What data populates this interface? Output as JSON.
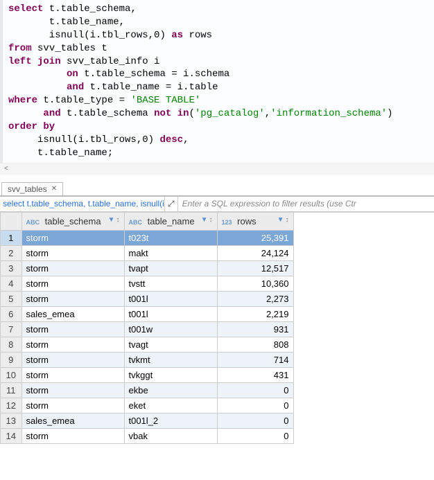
{
  "editor": {
    "sql_tokens": [
      [
        [
          "kw",
          "select"
        ],
        [
          "iden",
          " t.table_schema,"
        ]
      ],
      [
        [
          "iden",
          "       t.table_name,"
        ]
      ],
      [
        [
          "iden",
          "       isnull(i.tbl_rows,"
        ],
        [
          "num",
          "0"
        ],
        [
          "iden",
          ") "
        ],
        [
          "kw",
          "as"
        ],
        [
          "iden",
          " rows"
        ]
      ],
      [
        [
          "kw",
          "from"
        ],
        [
          "iden",
          " svv_tables t"
        ]
      ],
      [
        [
          "kw",
          "left join"
        ],
        [
          "iden",
          " svv_table_info i"
        ]
      ],
      [
        [
          "iden",
          "          "
        ],
        [
          "kw",
          "on"
        ],
        [
          "iden",
          " t.table_schema = i.schema"
        ]
      ],
      [
        [
          "iden",
          "          "
        ],
        [
          "kw",
          "and"
        ],
        [
          "iden",
          " t.table_name = i.table"
        ]
      ],
      [
        [
          "kw",
          "where"
        ],
        [
          "iden",
          " t.table_type = "
        ],
        [
          "strg",
          "'BASE TABLE'"
        ]
      ],
      [
        [
          "iden",
          "      "
        ],
        [
          "kw",
          "and"
        ],
        [
          "iden",
          " t.table_schema "
        ],
        [
          "kw",
          "not"
        ],
        [
          "iden",
          " "
        ],
        [
          "kw",
          "in"
        ],
        [
          "iden",
          "("
        ],
        [
          "strg",
          "'pg_catalog'"
        ],
        [
          "iden",
          ","
        ],
        [
          "strg",
          "'information_schema'"
        ],
        [
          "iden",
          ")"
        ]
      ],
      [
        [
          "kw",
          "order by"
        ]
      ],
      [
        [
          "iden",
          "     isnull(i.tbl_rows,"
        ],
        [
          "num",
          "0"
        ],
        [
          "iden",
          ") "
        ],
        [
          "kw",
          "desc"
        ],
        [
          "iden",
          ","
        ]
      ],
      [
        [
          "iden",
          "     t.table_name;"
        ]
      ]
    ]
  },
  "scroll_arrow": "<",
  "tabs": {
    "items": [
      {
        "label": "svv_tables"
      }
    ],
    "close_glyph": "✕"
  },
  "filter_bar": {
    "sql_snippet": "select t.table_schema, t.table_name, isnull(i.tbl",
    "expand_glyph": "⤢",
    "placeholder": "Enter a SQL expression to filter results (use Ctr"
  },
  "grid": {
    "columns": [
      {
        "type_badge": "ABC",
        "label": "table_schema"
      },
      {
        "type_badge": "ABC",
        "label": "table_name"
      },
      {
        "type_badge": "123",
        "label": "rows"
      }
    ],
    "filter_glyph": "▼",
    "sort_glyph": "↕",
    "rows": [
      {
        "n": "1",
        "schema": "storm",
        "tname": "t023t",
        "rows": "25,391",
        "selected": true
      },
      {
        "n": "2",
        "schema": "storm",
        "tname": "makt",
        "rows": "24,124",
        "selected": false
      },
      {
        "n": "3",
        "schema": "storm",
        "tname": "tvapt",
        "rows": "12,517",
        "selected": false
      },
      {
        "n": "4",
        "schema": "storm",
        "tname": "tvstt",
        "rows": "10,360",
        "selected": false
      },
      {
        "n": "5",
        "schema": "storm",
        "tname": "t001l",
        "rows": "2,273",
        "selected": false
      },
      {
        "n": "6",
        "schema": "sales_emea",
        "tname": "t001l",
        "rows": "2,219",
        "selected": false
      },
      {
        "n": "7",
        "schema": "storm",
        "tname": "t001w",
        "rows": "931",
        "selected": false
      },
      {
        "n": "8",
        "schema": "storm",
        "tname": "tvagt",
        "rows": "808",
        "selected": false
      },
      {
        "n": "9",
        "schema": "storm",
        "tname": "tvkmt",
        "rows": "714",
        "selected": false
      },
      {
        "n": "10",
        "schema": "storm",
        "tname": "tvkggt",
        "rows": "431",
        "selected": false
      },
      {
        "n": "11",
        "schema": "storm",
        "tname": "ekbe",
        "rows": "0",
        "selected": false
      },
      {
        "n": "12",
        "schema": "storm",
        "tname": "eket",
        "rows": "0",
        "selected": false
      },
      {
        "n": "13",
        "schema": "sales_emea",
        "tname": "t001l_2",
        "rows": "0",
        "selected": false
      },
      {
        "n": "14",
        "schema": "storm",
        "tname": "vbak",
        "rows": "0",
        "selected": false
      }
    ]
  }
}
